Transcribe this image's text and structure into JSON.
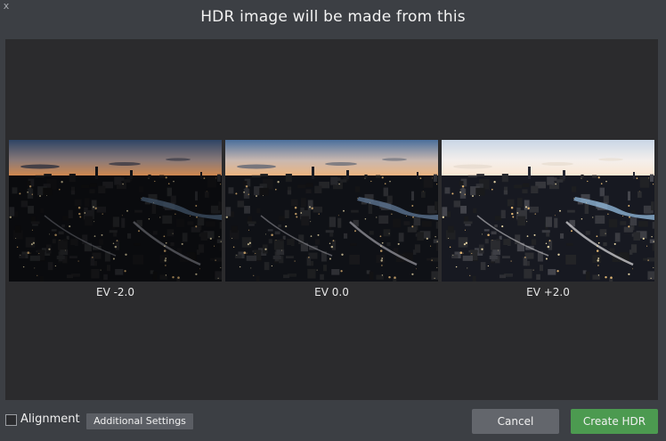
{
  "dialog": {
    "close_glyph": "x",
    "title": "HDR image will be made from this"
  },
  "images": [
    {
      "label": "EV -2.0",
      "brightness": 0.55
    },
    {
      "label": "EV 0.0",
      "brightness": 0.85
    },
    {
      "label": "EV +2.0",
      "brightness": 1.25
    }
  ],
  "footer": {
    "alignment_label": "Alignment",
    "alignment_checked": false,
    "additional_settings_label": "Additional Settings",
    "cancel_label": "Cancel",
    "create_label": "Create HDR"
  },
  "colors": {
    "accent_green": "#4c9a50",
    "panel_bg": "#2b2b2d",
    "dialog_bg": "#3c3f44"
  }
}
